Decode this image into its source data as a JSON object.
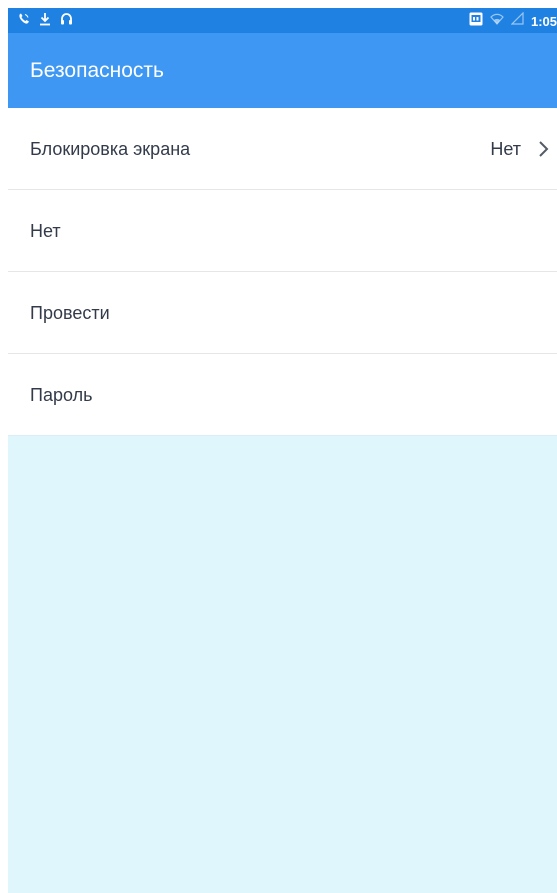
{
  "status_bar": {
    "time": "1:05",
    "left_icons": [
      "call-icon",
      "download-icon",
      "headset-icon"
    ],
    "right_icons": [
      "gallery-icon",
      "wifi-icon",
      "signal-icon"
    ]
  },
  "app_bar": {
    "title": "Безопасность"
  },
  "list": {
    "items": [
      {
        "label": "Блокировка экрана",
        "value": "Нет"
      },
      {
        "label": "Нет"
      },
      {
        "label": "Провести"
      },
      {
        "label": "Пароль"
      }
    ]
  },
  "colors": {
    "status_bar": "#1f82e3",
    "app_bar": "#3e97f3",
    "background": "#e0f6fd",
    "text": "#333b4a"
  }
}
